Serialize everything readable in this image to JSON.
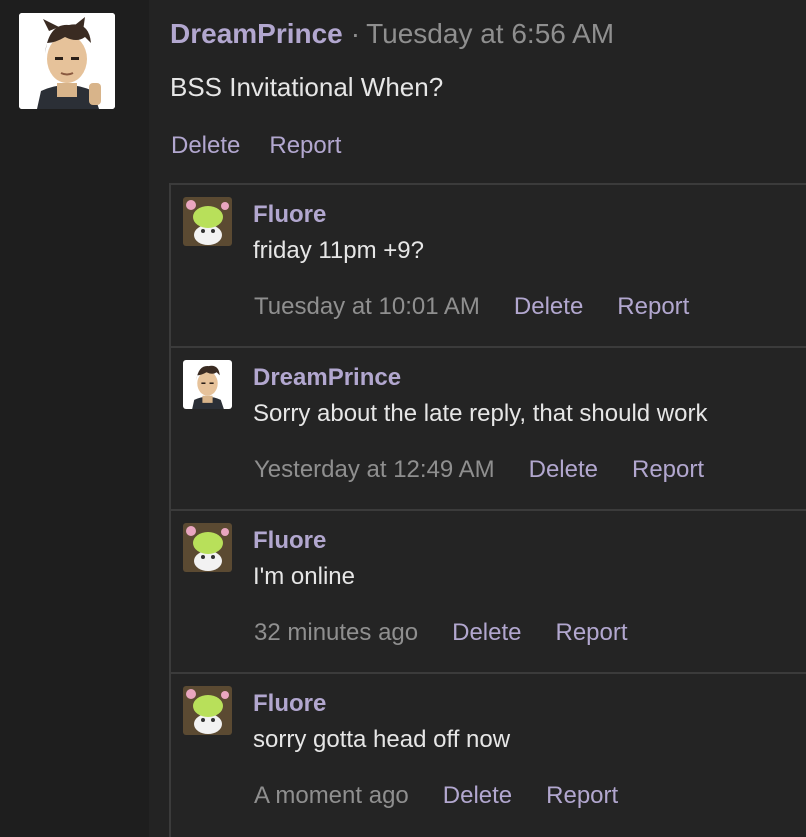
{
  "post": {
    "author": "DreamPrince",
    "separator": "·",
    "time": "Tuesday at 6:56 AM",
    "body": "BSS Invitational When?",
    "delete_label": "Delete",
    "report_label": "Report"
  },
  "replies": [
    {
      "author": "Fluore",
      "text": "friday 11pm +9?",
      "time": "Tuesday at 10:01 AM",
      "delete_label": "Delete",
      "report_label": "Report",
      "avatar": "fluore-avatar"
    },
    {
      "author": "DreamPrince",
      "text": "Sorry about the late reply, that should work",
      "time": "Yesterday at 12:49 AM",
      "delete_label": "Delete",
      "report_label": "Report",
      "avatar": "dreamprince-avatar"
    },
    {
      "author": "Fluore",
      "text": "I'm online",
      "time": "32 minutes ago",
      "delete_label": "Delete",
      "report_label": "Report",
      "avatar": "fluore-avatar"
    },
    {
      "author": "Fluore",
      "text": "sorry gotta head off now",
      "time": "A moment ago",
      "delete_label": "Delete",
      "report_label": "Report",
      "avatar": "fluore-avatar"
    }
  ],
  "colors": {
    "accent": "#b2a7cf",
    "muted": "#8f8f8f",
    "text": "#e6e6e6",
    "background": "#232323",
    "border": "#3b3b3b"
  }
}
